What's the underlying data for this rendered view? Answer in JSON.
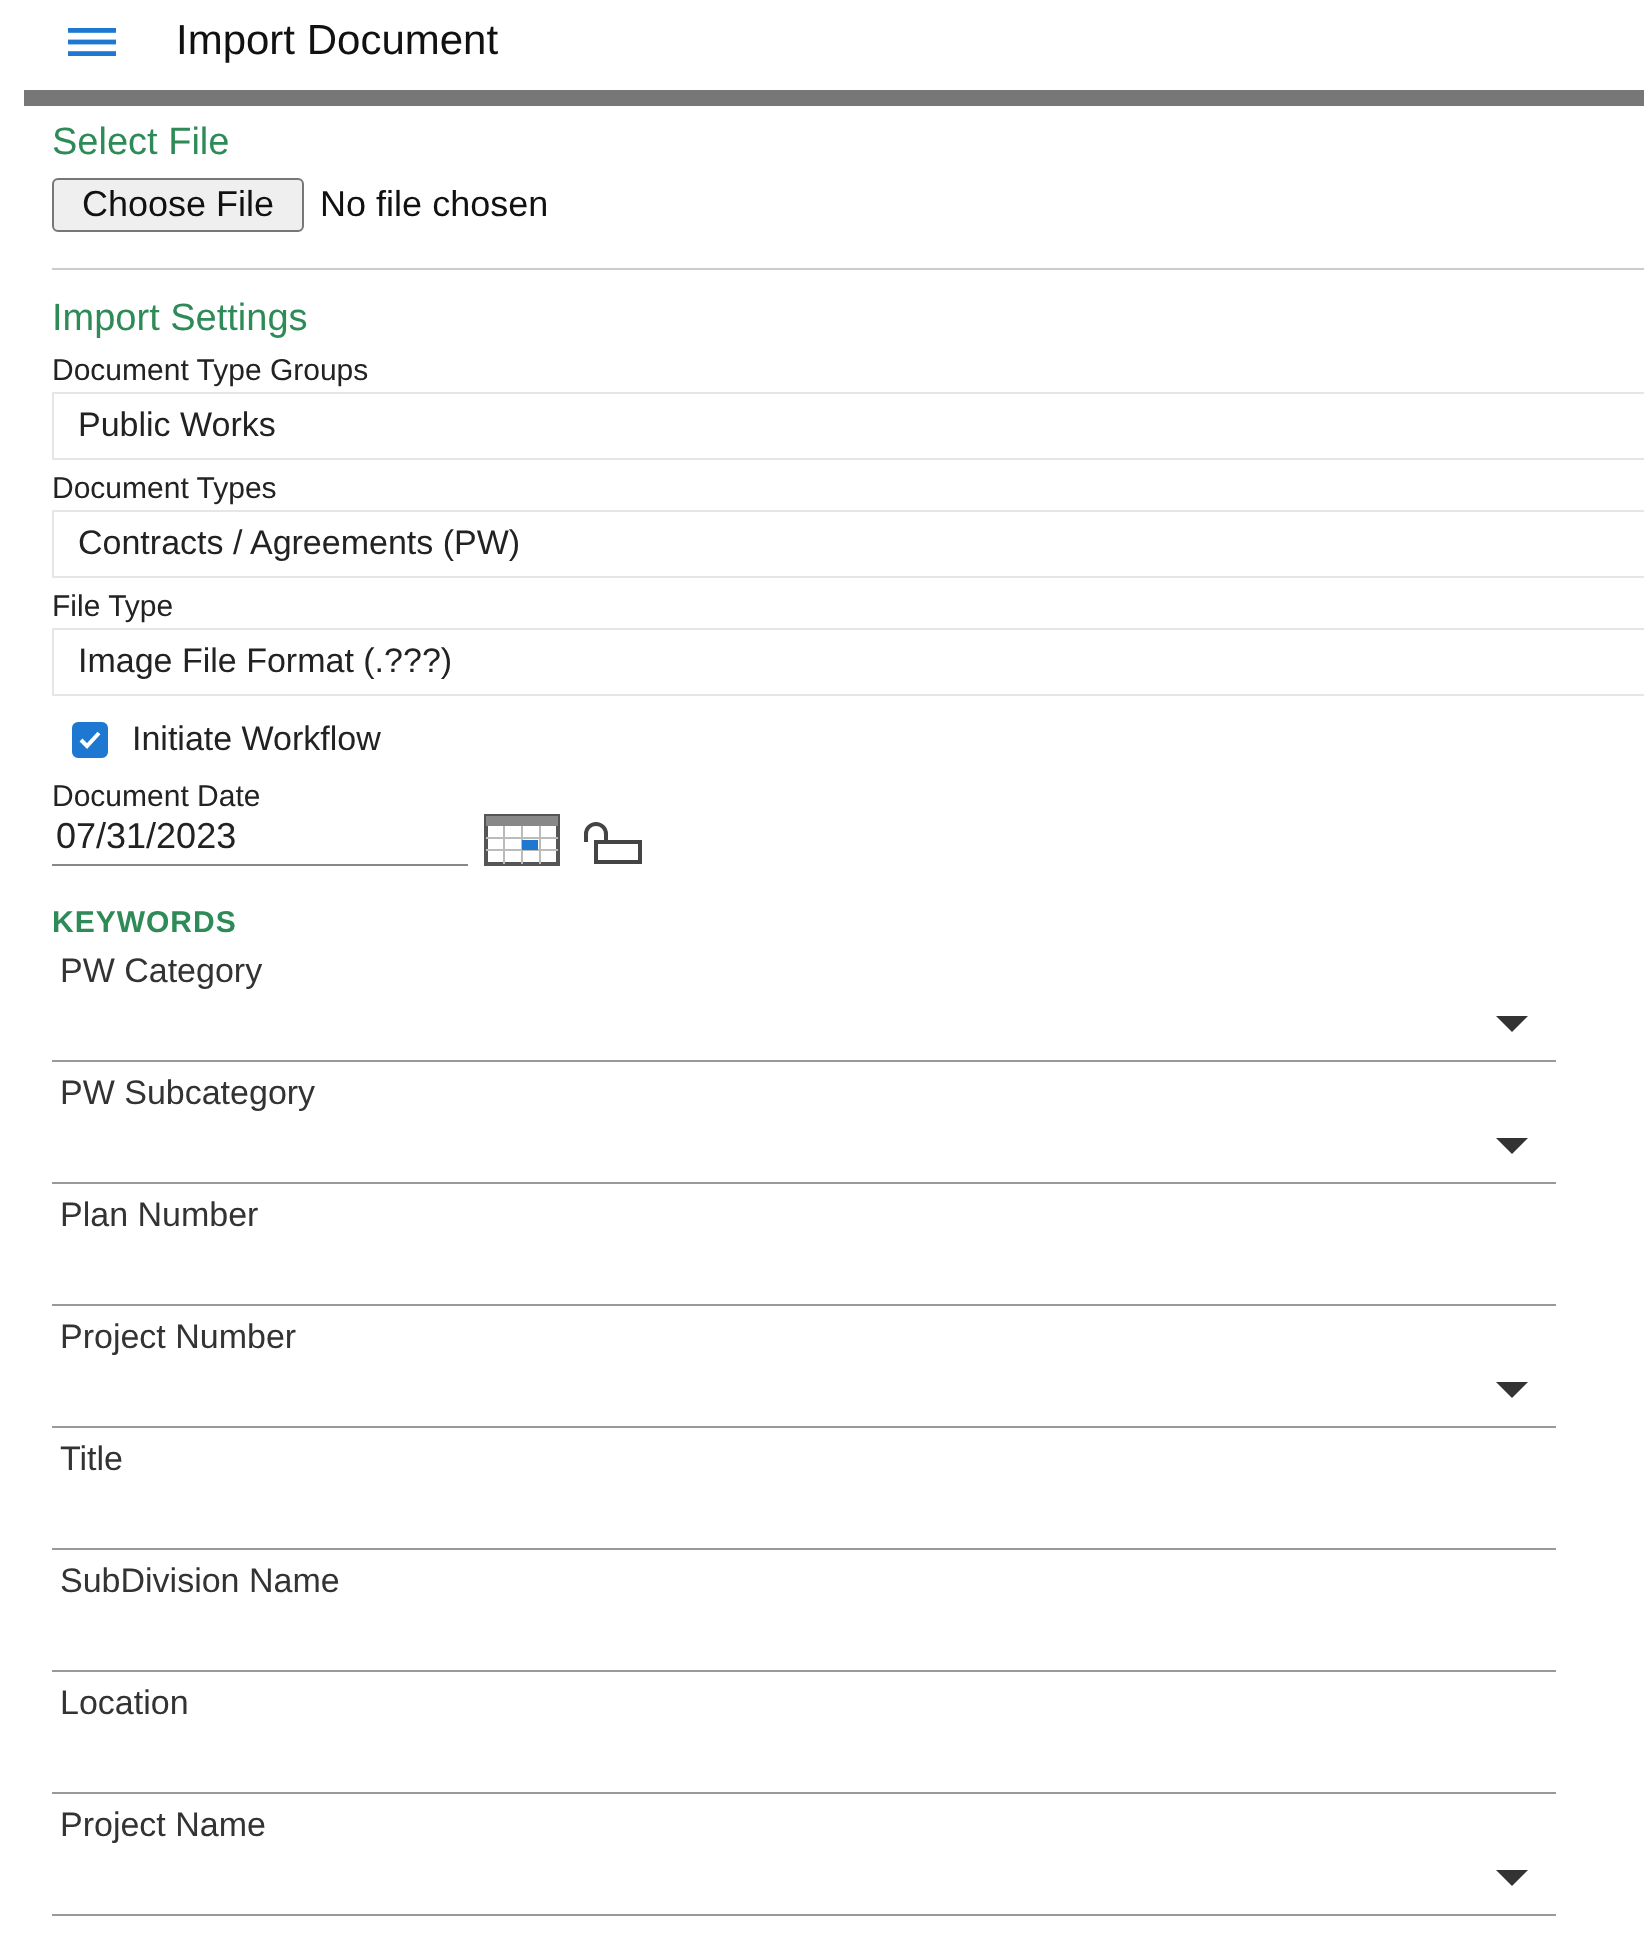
{
  "header": {
    "title": "Import Document"
  },
  "select_file": {
    "heading": "Select File",
    "button": "Choose File",
    "status": "No file chosen"
  },
  "import_settings": {
    "heading": "Import Settings",
    "selects": [
      {
        "label": "Document Type Groups",
        "value": "Public Works"
      },
      {
        "label": "Document Types",
        "value": "Contracts / Agreements (PW)"
      },
      {
        "label": "File Type",
        "value": "Image File Format (.???)"
      }
    ],
    "workflow": {
      "label": "Initiate Workflow",
      "checked": true
    },
    "date": {
      "label": "Document Date",
      "value": "07/31/2023"
    }
  },
  "keywords": {
    "heading": "KEYWORDS",
    "fields": [
      {
        "label": "PW Category",
        "kind": "dropdown"
      },
      {
        "label": "PW Subcategory",
        "kind": "dropdown"
      },
      {
        "label": "Plan Number",
        "kind": "text"
      },
      {
        "label": "Project Number",
        "kind": "dropdown"
      },
      {
        "label": "Title",
        "kind": "text"
      },
      {
        "label": "SubDivision Name",
        "kind": "text"
      },
      {
        "label": "Location",
        "kind": "text"
      },
      {
        "label": "Project Name",
        "kind": "dropdown"
      }
    ]
  }
}
